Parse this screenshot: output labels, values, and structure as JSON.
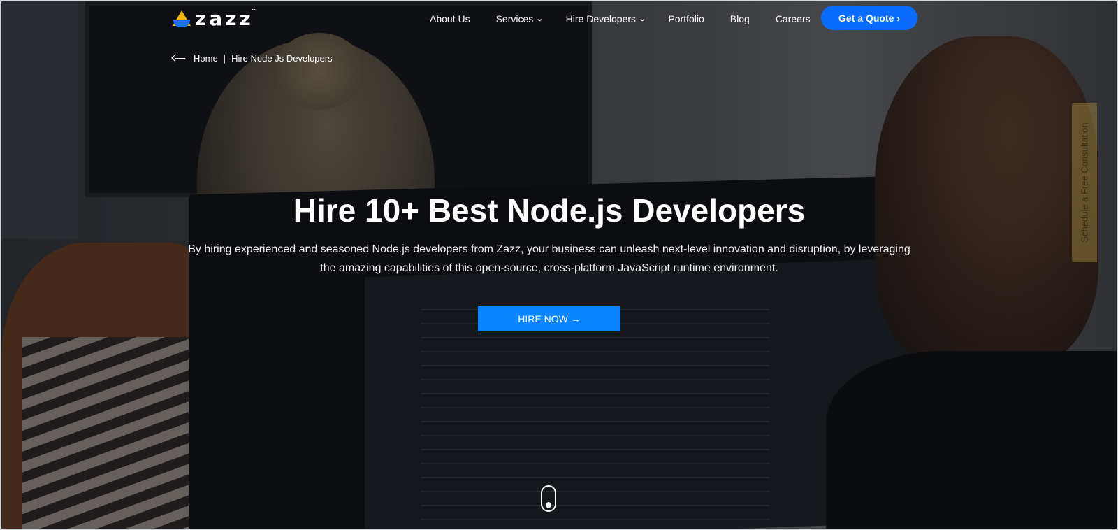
{
  "logo": {
    "text": "zazz",
    "trademark": "™"
  },
  "nav": {
    "items": [
      {
        "label": "About Us"
      },
      {
        "label": "Services"
      },
      {
        "label": "Hire Developers"
      },
      {
        "label": "Portfolio"
      },
      {
        "label": "Blog"
      },
      {
        "label": "Careers"
      }
    ],
    "cta_label": "Get a Quote ›"
  },
  "breadcrumb": {
    "home": "Home",
    "separator": "|",
    "current": "Hire Node Js Developers"
  },
  "hero": {
    "title": "Hire 10+ Best Node.js Developers",
    "description": "By hiring experienced and seasoned Node.js developers from Zazz, your business can unleash next-level innovation and disruption, by leveraging the amazing capabilities of this open-source, cross-platform JavaScript runtime environment.",
    "button_label": "HIRE NOW →"
  },
  "side_tab": {
    "label": "Schedule a Free Consultation"
  },
  "colors": {
    "accent_blue": "#0a6cff",
    "button_blue": "#0a84ff",
    "logo_yellow": "#f4b400",
    "logo_blue": "#1a73e8"
  },
  "icons": {
    "dropdown": "chevron-down-icon",
    "back": "back-arrow-icon",
    "scroll": "scroll-mouse-icon"
  }
}
